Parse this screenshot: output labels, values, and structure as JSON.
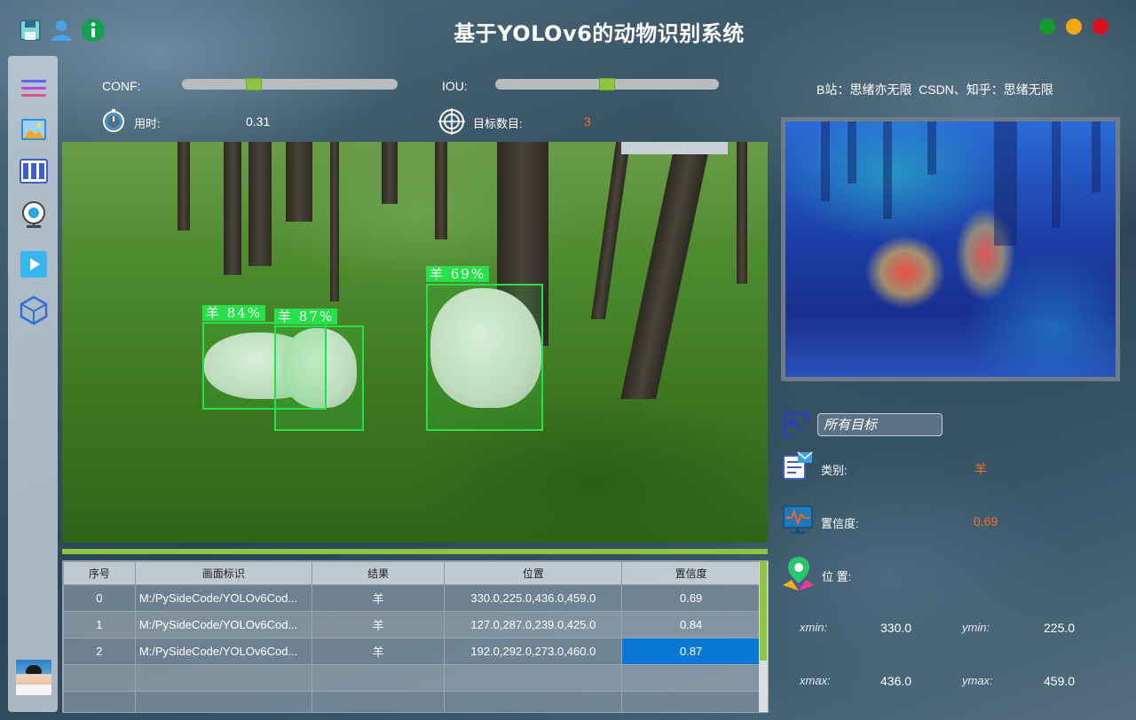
{
  "header": {
    "title": "基于YOLOv6的动物识别系统",
    "attribution": "B站：思绪亦无限  CSDN、知乎：思绪无限",
    "window_dots": [
      "#139b2e",
      "#f3a712",
      "#d9101b"
    ]
  },
  "controls": {
    "conf_label": "CONF:",
    "conf_value": 0.32,
    "iou_label": "IOU:",
    "iou_value": 0.5,
    "time_label": "用时:",
    "time_value": "0.31",
    "count_label": "目标数目:",
    "count_value": "3"
  },
  "detections": [
    {
      "label": "羊  84%"
    },
    {
      "label": "羊  87%"
    },
    {
      "label": "羊  69%"
    }
  ],
  "table": {
    "headers": [
      "序号",
      "画面标识",
      "结果",
      "位置",
      "置信度"
    ],
    "rows": [
      {
        "idx": "0",
        "path": "M:/PySideCode/YOLOv6Cod...",
        "result": "羊",
        "pos": "330.0,225.0,436.0,459.0",
        "conf": "0.69"
      },
      {
        "idx": "1",
        "path": "M:/PySideCode/YOLOv6Cod...",
        "result": "羊",
        "pos": "127.0,287.0,239.0,425.0",
        "conf": "0.84"
      },
      {
        "idx": "2",
        "path": "M:/PySideCode/YOLOv6Cod...",
        "result": "羊",
        "pos": "192.0,292.0,273.0,460.0",
        "conf": "0.87"
      }
    ]
  },
  "target_panel": {
    "select_value": "所有目标",
    "class_label": "类别:",
    "class_value": "羊",
    "conf_label": "置信度:",
    "conf_value": "0.69",
    "position_label": "位 置:",
    "xmin_label": "xmin:",
    "xmin": "330.0",
    "ymin_label": "ymin:",
    "ymin": "225.0",
    "xmax_label": "xmax:",
    "xmax": "436.0",
    "ymax_label": "ymax:",
    "ymax": "459.0"
  },
  "accent_color": "#8cc63f",
  "highlight_color": "#ff6a2a",
  "selection_color": "#0a78d7"
}
